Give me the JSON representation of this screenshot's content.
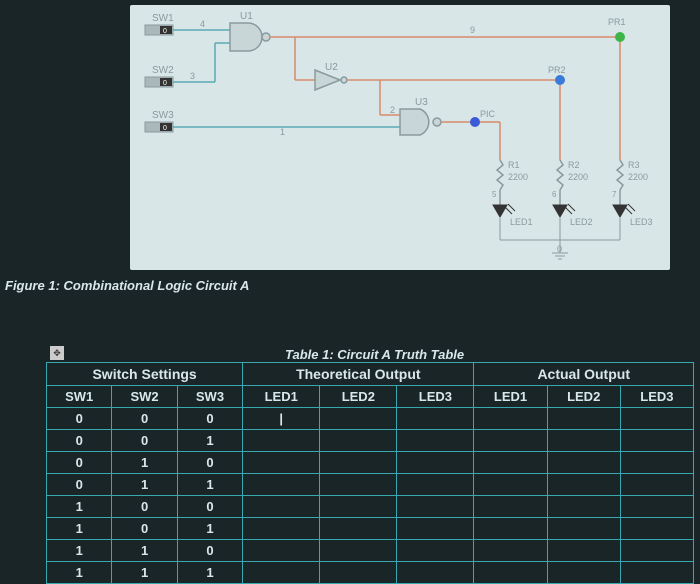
{
  "figure_caption": "Figure 1: Combinational Logic Circuit A",
  "table_title": "Table 1: Circuit A Truth Table",
  "circuit": {
    "switches": [
      "SW1",
      "SW2",
      "SW3"
    ],
    "gates": [
      "U1",
      "U2",
      "U3"
    ],
    "probes": [
      "PR1",
      "PR2",
      "PIC"
    ],
    "resistors": [
      {
        "name": "R1",
        "value": "2200"
      },
      {
        "name": "R2",
        "value": "2200"
      },
      {
        "name": "R3",
        "value": "2200"
      }
    ],
    "leds": [
      "LED1",
      "LED2",
      "LED3"
    ]
  },
  "table": {
    "group_headers": [
      "Switch Settings",
      "Theoretical Output",
      "Actual Output"
    ],
    "col_headers": [
      "SW1",
      "SW2",
      "SW3",
      "LED1",
      "LED2",
      "LED3",
      "LED1",
      "LED2",
      "LED3"
    ],
    "rows": [
      {
        "sw1": "0",
        "sw2": "0",
        "sw3": "0",
        "t1": "",
        "t2": "",
        "t3": "",
        "a1": "",
        "a2": "",
        "a3": ""
      },
      {
        "sw1": "0",
        "sw2": "0",
        "sw3": "1",
        "t1": "",
        "t2": "",
        "t3": "",
        "a1": "",
        "a2": "",
        "a3": ""
      },
      {
        "sw1": "0",
        "sw2": "1",
        "sw3": "0",
        "t1": "",
        "t2": "",
        "t3": "",
        "a1": "",
        "a2": "",
        "a3": ""
      },
      {
        "sw1": "0",
        "sw2": "1",
        "sw3": "1",
        "t1": "",
        "t2": "",
        "t3": "",
        "a1": "",
        "a2": "",
        "a3": ""
      },
      {
        "sw1": "1",
        "sw2": "0",
        "sw3": "0",
        "t1": "",
        "t2": "",
        "t3": "",
        "a1": "",
        "a2": "",
        "a3": ""
      },
      {
        "sw1": "1",
        "sw2": "0",
        "sw3": "1",
        "t1": "",
        "t2": "",
        "t3": "",
        "a1": "",
        "a2": "",
        "a3": ""
      },
      {
        "sw1": "1",
        "sw2": "1",
        "sw3": "0",
        "t1": "",
        "t2": "",
        "t3": "",
        "a1": "",
        "a2": "",
        "a3": ""
      },
      {
        "sw1": "1",
        "sw2": "1",
        "sw3": "1",
        "t1": "",
        "t2": "",
        "t3": "",
        "a1": "",
        "a2": "",
        "a3": ""
      }
    ]
  },
  "cursor": "|"
}
